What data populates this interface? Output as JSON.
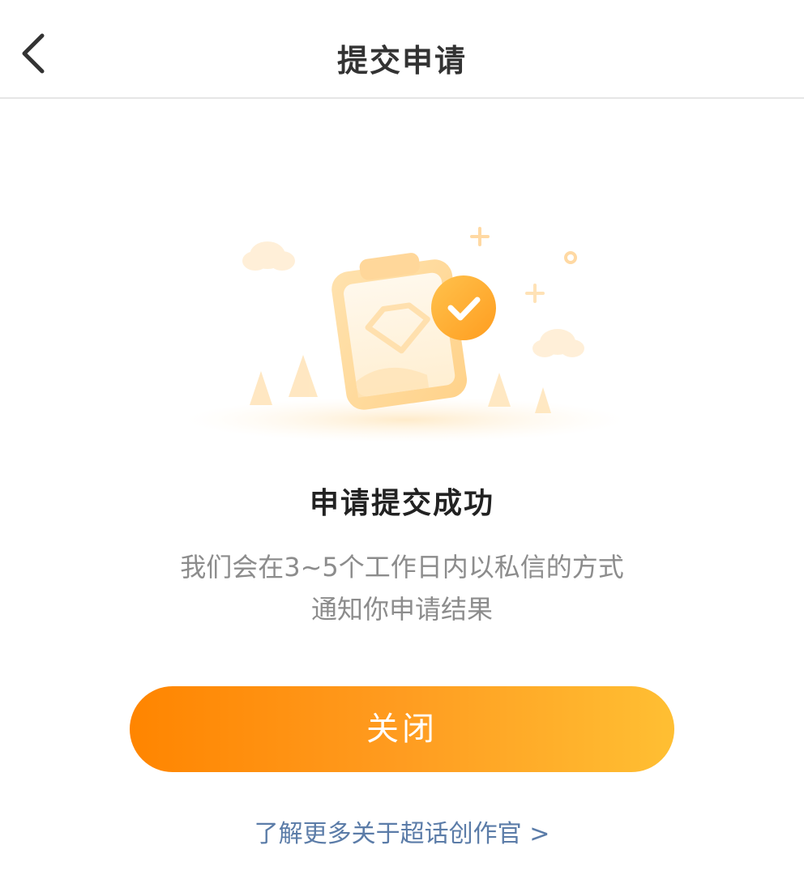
{
  "nav": {
    "title": "提交申请",
    "back_icon": "chevron-left-icon"
  },
  "result": {
    "illustration": "clipboard-check-illustration",
    "title": "申请提交成功",
    "desc_line_1": "我们会在3~5个工作日内以私信的方式",
    "desc_line_2": "通知你申请结果"
  },
  "actions": {
    "close_label": "关闭",
    "learn_more_label": "了解更多关于超话创作官 >"
  },
  "colors": {
    "accent_start": "#ff8500",
    "accent_end": "#ffbf33",
    "link": "#5b7ca8",
    "title": "#333333",
    "secondary_text": "#8c8c8c"
  }
}
